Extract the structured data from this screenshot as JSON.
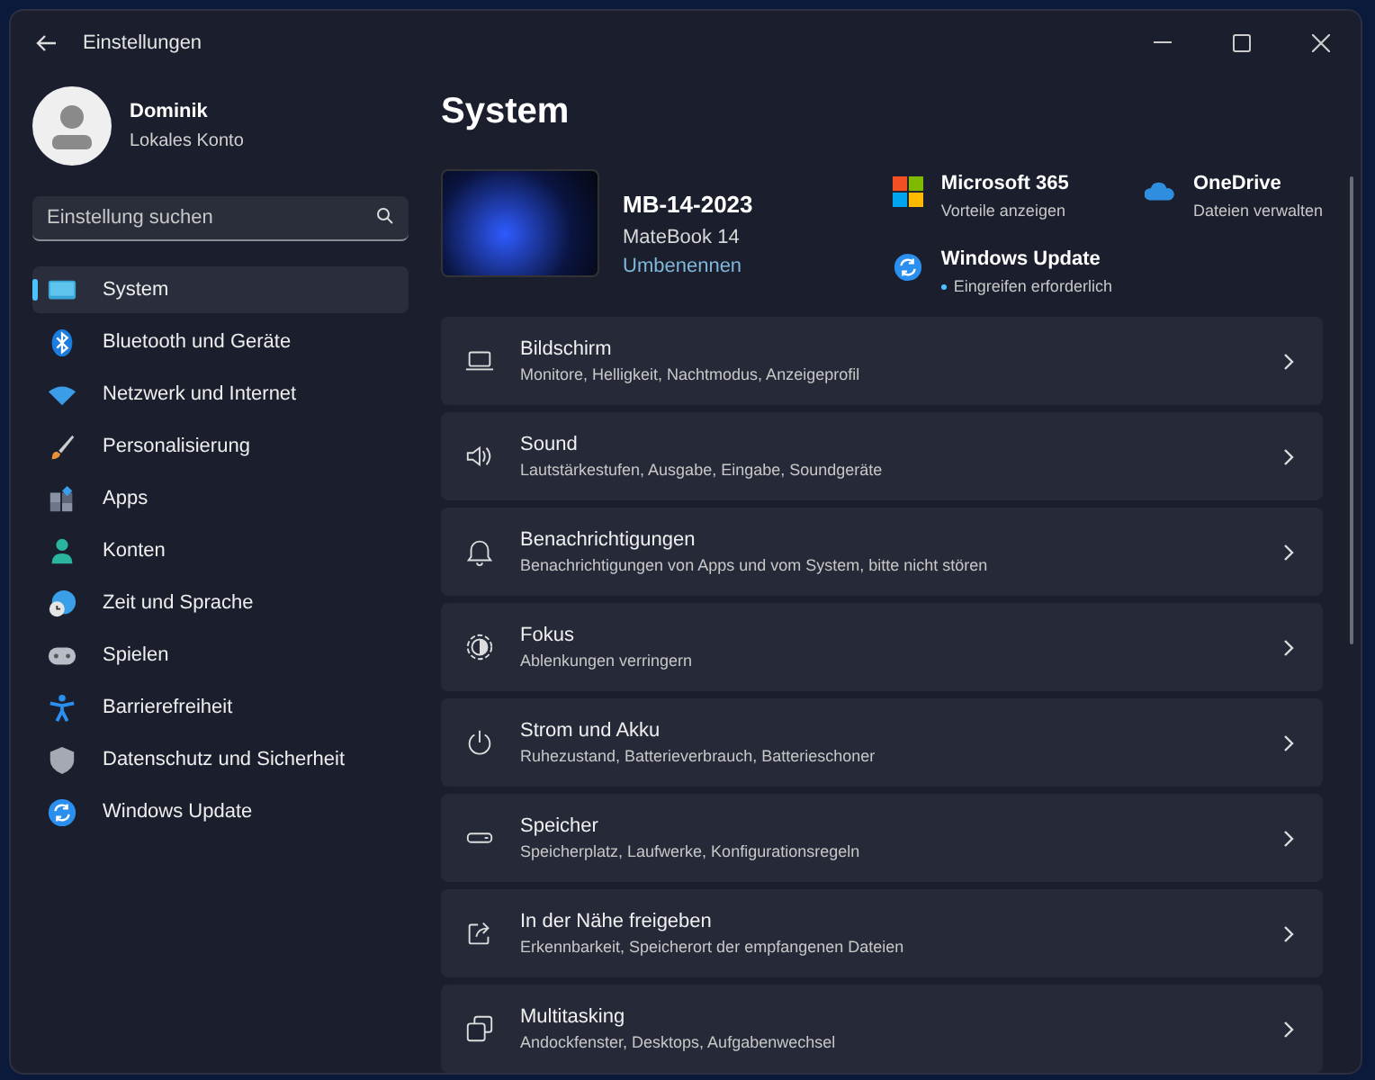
{
  "window": {
    "title": "Einstellungen"
  },
  "account": {
    "name": "Dominik",
    "type": "Lokales Konto"
  },
  "search": {
    "placeholder": "Einstellung suchen"
  },
  "sidebar": {
    "items": [
      {
        "kind": "system",
        "label": "System",
        "selected": true
      },
      {
        "kind": "bluetooth",
        "label": "Bluetooth und Geräte",
        "selected": false
      },
      {
        "kind": "network",
        "label": "Netzwerk und Internet",
        "selected": false
      },
      {
        "kind": "brush",
        "label": "Personalisierung",
        "selected": false
      },
      {
        "kind": "apps",
        "label": "Apps",
        "selected": false
      },
      {
        "kind": "person",
        "label": "Konten",
        "selected": false
      },
      {
        "kind": "clock",
        "label": "Zeit und Sprache",
        "selected": false
      },
      {
        "kind": "gamepad",
        "label": "Spielen",
        "selected": false
      },
      {
        "kind": "accessibility",
        "label": "Barrierefreiheit",
        "selected": false
      },
      {
        "kind": "shield",
        "label": "Datenschutz und Sicherheit",
        "selected": false
      },
      {
        "kind": "update",
        "label": "Windows Update",
        "selected": false
      }
    ]
  },
  "page": {
    "title": "System"
  },
  "device": {
    "name": "MB-14-2023",
    "model": "MateBook 14",
    "rename_link": "Umbenennen"
  },
  "quick_links": [
    {
      "kind": "office",
      "title": "Microsoft 365",
      "subtitle": "Vorteile anzeigen",
      "alert": false
    },
    {
      "kind": "cloud",
      "title": "OneDrive",
      "subtitle": "Dateien verwalten",
      "alert": false
    },
    {
      "kind": "update",
      "title": "Windows Update",
      "subtitle": "Eingreifen erforderlich",
      "alert": true
    }
  ],
  "settings": [
    {
      "kind": "display",
      "title": "Bildschirm",
      "subtitle": "Monitore, Helligkeit, Nachtmodus, Anzeigeprofil"
    },
    {
      "kind": "sound",
      "title": "Sound",
      "subtitle": "Lautstärkestufen, Ausgabe, Eingabe, Soundgeräte"
    },
    {
      "kind": "bell",
      "title": "Benachrichtigungen",
      "subtitle": "Benachrichtigungen von Apps und vom System, bitte nicht stören"
    },
    {
      "kind": "focus",
      "title": "Fokus",
      "subtitle": "Ablenkungen verringern"
    },
    {
      "kind": "power",
      "title": "Strom und Akku",
      "subtitle": "Ruhezustand, Batterieverbrauch, Batterieschoner"
    },
    {
      "kind": "storage",
      "title": "Speicher",
      "subtitle": "Speicherplatz, Laufwerke, Konfigurationsregeln"
    },
    {
      "kind": "share",
      "title": "In der Nähe freigeben",
      "subtitle": "Erkennbarkeit, Speicherort der empfangenen Dateien"
    },
    {
      "kind": "multitask",
      "title": "Multitasking",
      "subtitle": "Andockfenster, Desktops, Aufgabenwechsel"
    }
  ]
}
